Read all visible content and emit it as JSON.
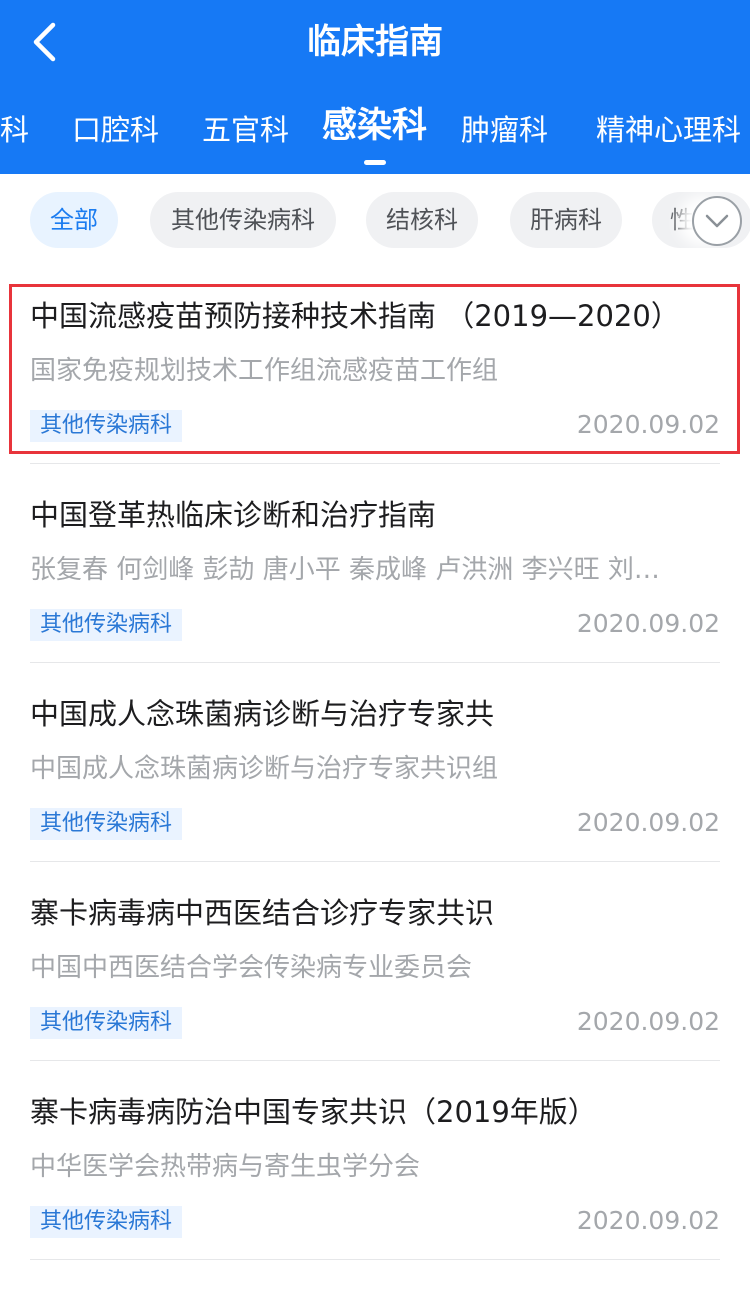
{
  "header": {
    "title": "临床指南",
    "back_icon": "chevron-left-icon",
    "background_color": "#1679f5"
  },
  "tabs": [
    {
      "label": "科"
    },
    {
      "label": "口腔科"
    },
    {
      "label": "五官科"
    },
    {
      "label": "感染科",
      "active": true
    },
    {
      "label": "肿瘤科"
    },
    {
      "label": "精神心理科"
    }
  ],
  "filters": {
    "chips": [
      {
        "label": "全部",
        "active": true
      },
      {
        "label": "其他传染病科"
      },
      {
        "label": "结核科"
      },
      {
        "label": "肝病科"
      },
      {
        "label": "性"
      }
    ],
    "expand_icon": "chevron-down-icon"
  },
  "items": [
    {
      "title": "中国流感疫苗预防接种技术指南 （2019—2020）",
      "author": "国家免疫规划技术工作组流感疫苗工作组",
      "tag": "其他传染病科",
      "date": "2020.09.02",
      "highlighted": true
    },
    {
      "title": "中国登革热临床诊断和治疗指南",
      "author": "张复春 何剑峰 彭劼 唐小平 秦成峰 卢洪洲 李兴旺 刘…",
      "tag": "其他传染病科",
      "date": "2020.09.02"
    },
    {
      "title": "中国成人念珠菌病诊断与治疗专家共",
      "author": "中国成人念珠菌病诊断与治疗专家共识组",
      "tag": "其他传染病科",
      "date": "2020.09.02"
    },
    {
      "title": "寨卡病毒病中西医结合诊疗专家共识",
      "author": "中国中西医结合学会传染病专业委员会",
      "tag": "其他传染病科",
      "date": "2020.09.02"
    },
    {
      "title": "寨卡病毒病防治中国专家共识（2019年版）",
      "author": "中华医学会热带病与寄生虫学分会",
      "tag": "其他传染病科",
      "date": "2020.09.02"
    }
  ],
  "highlight_color": "#e8343b"
}
